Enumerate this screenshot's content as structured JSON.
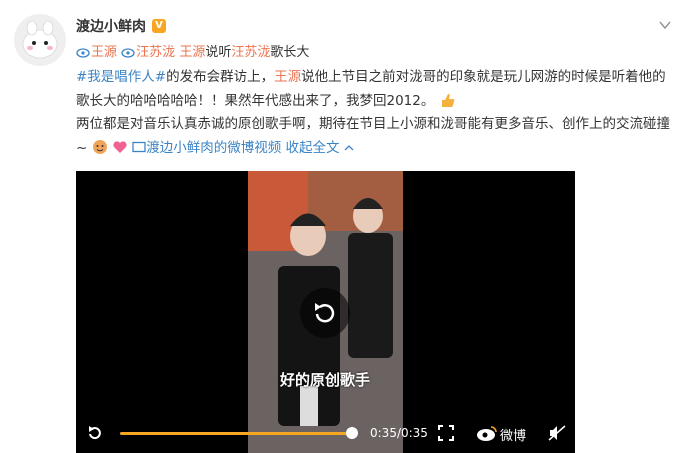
{
  "post": {
    "author": "渡边小鲜肉",
    "badge": "V",
    "mentions": [
      {
        "text": "王源"
      },
      {
        "text": "汪苏泷"
      }
    ],
    "tag_line_rest": "说听",
    "tag_line_mid": "王源",
    "tag_line_name": "汪苏泷",
    "tag_line_tail": "歌长大",
    "p1_hashtag": "#我是唱作人#",
    "p1_a": "的发布会群访上，",
    "p1_name": "王源",
    "p1_b": "说他上节目之前对泷哥的印象就是玩儿网游的时候是听着他的歌长大的哈哈哈哈哈！！果然年代感出来了，我梦回2012。",
    "p2": "两位都是对音乐认真赤诚的原创歌手啊，期待在节目上小源和泷哥能有更多音乐、创作上的交流碰撞~",
    "video_link": "渡边小鲜肉的微博视频",
    "collapse": "收起全文"
  },
  "video": {
    "subtitle": "好的原创歌手",
    "time": "0:35/0:35",
    "progress": 1.0,
    "weibo_label": "微博"
  }
}
